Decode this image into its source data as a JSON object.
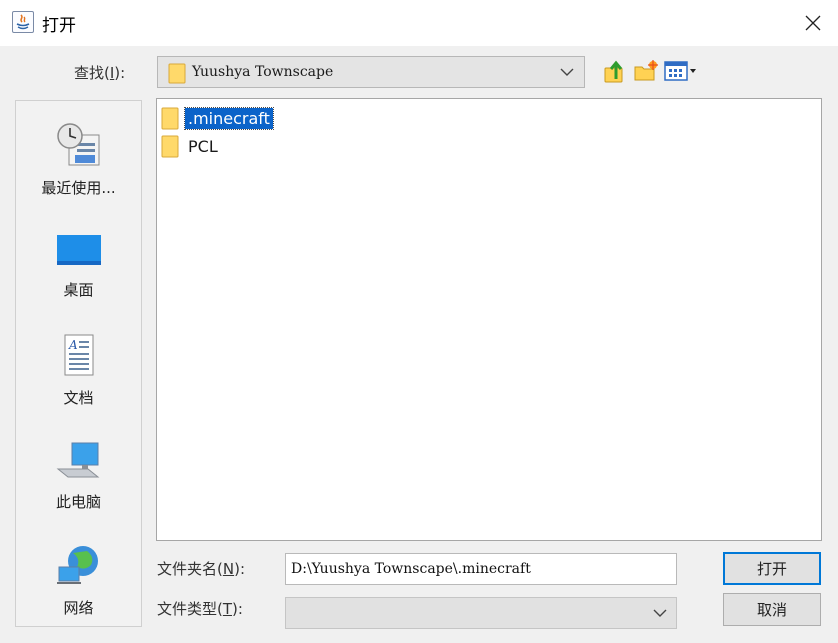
{
  "window": {
    "title": "打开"
  },
  "lookin": {
    "label_pre": "查找(",
    "label_key": "I",
    "label_post": "):",
    "value": "Yuushya Townscape"
  },
  "toolbar": {
    "up": "up-one-level-icon",
    "newfolder": "new-folder-icon",
    "view": "view-menu-icon"
  },
  "sidebar": {
    "items": [
      {
        "label": "最近使用...",
        "icon": "recent-items-icon"
      },
      {
        "label": "桌面",
        "icon": "desktop-icon"
      },
      {
        "label": "文档",
        "icon": "documents-icon"
      },
      {
        "label": "此电脑",
        "icon": "computer-icon"
      },
      {
        "label": "网络",
        "icon": "network-icon"
      }
    ]
  },
  "files": [
    {
      "name": ".minecraft",
      "selected": true
    },
    {
      "name": "PCL",
      "selected": false
    }
  ],
  "filename": {
    "label_pre": "文件夹名(",
    "label_key": "N",
    "label_post": "):",
    "value": "D:\\Yuushya Townscape\\.minecraft"
  },
  "filetype": {
    "label_pre": "文件类型(",
    "label_key": "T",
    "label_post": "):",
    "value": ""
  },
  "buttons": {
    "open": "打开",
    "cancel": "取消"
  },
  "colors": {
    "selection": "#0b63c9",
    "folder": "#ffd96a",
    "desktop": "#1e8ee8"
  }
}
